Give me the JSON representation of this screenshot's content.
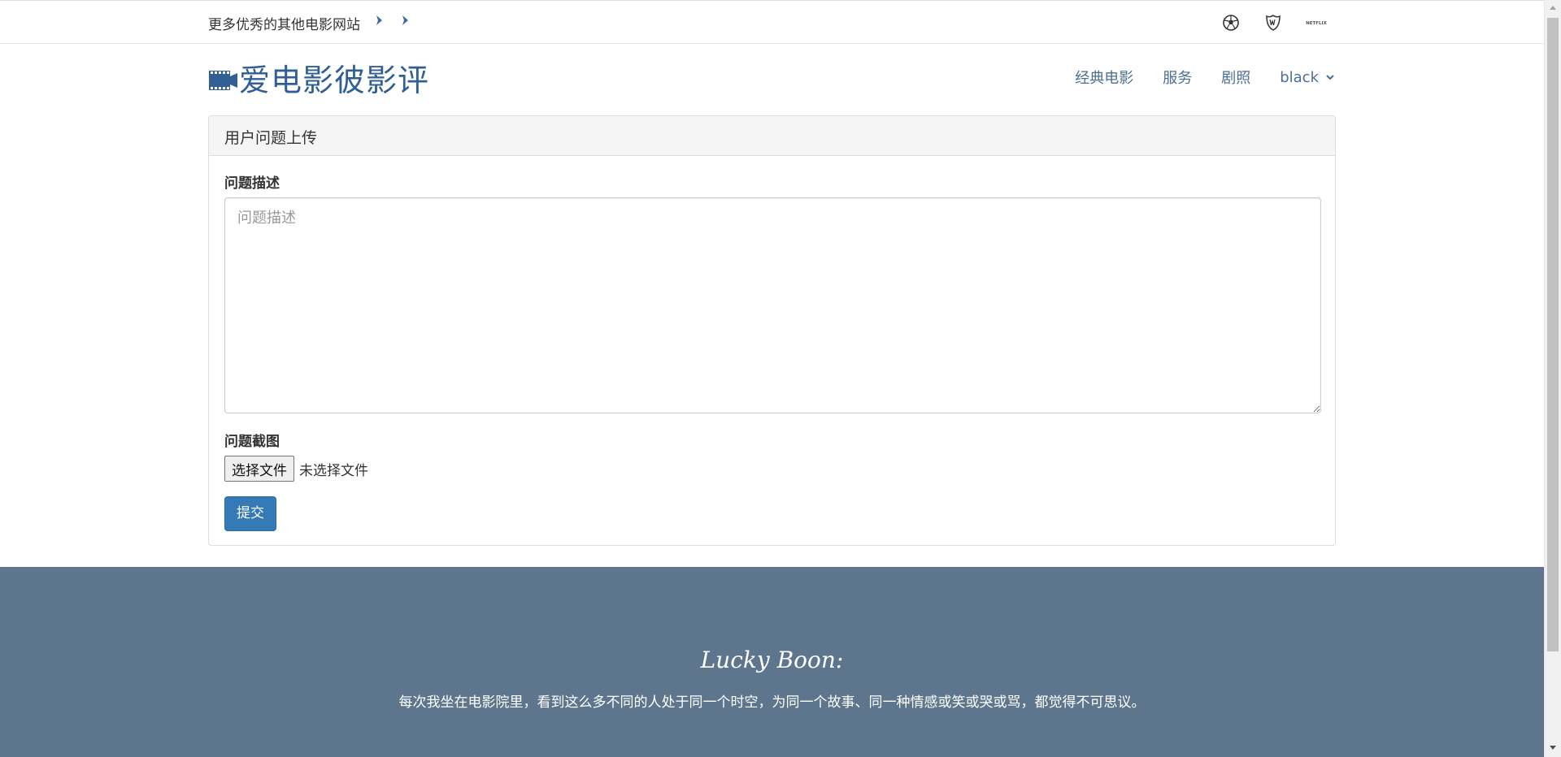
{
  "topbar": {
    "link_text": "更多优秀的其他电影网站",
    "icons": [
      "soccer-ball-icon",
      "warner-bros-shield-icon",
      "netflix-logo-icon"
    ],
    "netflix_text": "NETFLIX"
  },
  "header": {
    "logo_text": "爱电影彼影评",
    "nav": {
      "classic": "经典电影",
      "service": "服务",
      "stills": "剧照",
      "user": "black"
    }
  },
  "panel": {
    "heading": "用户问题上传",
    "description_label": "问题描述",
    "description_placeholder": "问题描述",
    "screenshot_label": "问题截图",
    "file_button": "选择文件",
    "file_status": "未选择文件",
    "submit_label": "提交"
  },
  "footer": {
    "title": "Lucky Boon:",
    "quote": "每次我坐在电影院里，看到这么多不同的人处于同一个时空，为同一个故事、同一种情感或笑或哭或骂，都觉得不可思议。"
  },
  "colors": {
    "brand": "#2f5f94",
    "nav": "#4a6f94",
    "primary_button": "#337ab7",
    "footer_bg": "#5d768d"
  }
}
